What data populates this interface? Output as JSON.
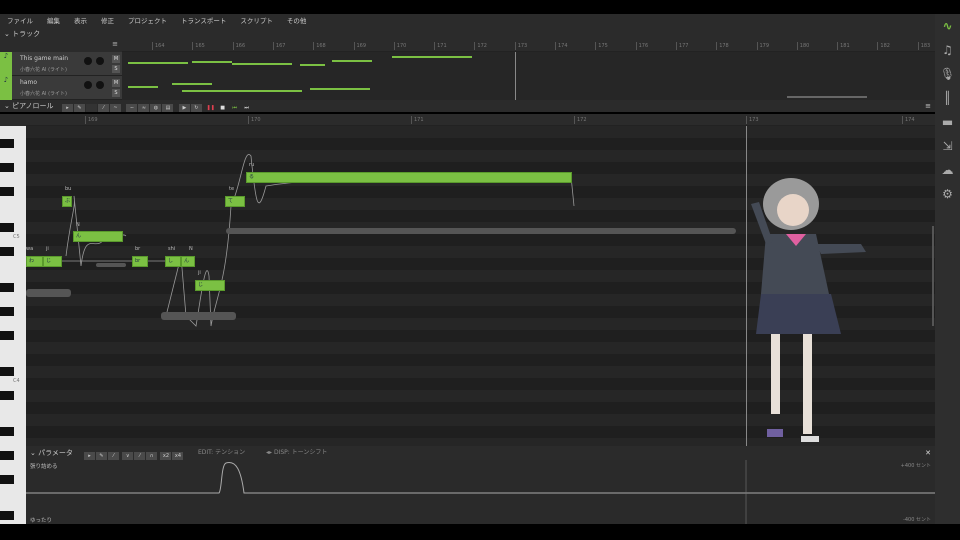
{
  "menu": [
    "ファイル",
    "編集",
    "表示",
    "修正",
    "プロジェクト",
    "トランスポート",
    "スクリプト",
    "その他"
  ],
  "track_panel": {
    "title": "トラック",
    "ruler": [
      "164",
      "165",
      "166",
      "167",
      "168",
      "169",
      "170",
      "171",
      "172",
      "173",
      "174",
      "175",
      "176",
      "177",
      "178",
      "179",
      "180",
      "181",
      "182",
      "183"
    ],
    "tracks": [
      {
        "name": "This game main",
        "voice": "小春六花 AI (ライト)",
        "mute": "M",
        "solo": "S"
      },
      {
        "name": "hamo",
        "voice": "小春六花 AI (ライト)",
        "mute": "M",
        "solo": "S"
      }
    ]
  },
  "piano_roll": {
    "title": "ピアノロール",
    "ruler": [
      "169",
      "170",
      "171",
      "172",
      "173",
      "174"
    ],
    "key_labels": {
      "c5": "C5",
      "c4": "C4"
    },
    "notes": [
      {
        "lyric": "bu",
        "text": "ぶ"
      },
      {
        "lyric": "N",
        "text": "ん"
      },
      {
        "lyric": "wa",
        "text": "わ"
      },
      {
        "lyric": "ji",
        "text": "じ"
      },
      {
        "lyric": "br",
        "text": "br"
      },
      {
        "lyric": "shi",
        "text": "し"
      },
      {
        "lyric": "N",
        "text": "ん"
      },
      {
        "lyric": "ji",
        "text": "じ"
      },
      {
        "lyric": "te",
        "text": "て"
      },
      {
        "lyric": "ru",
        "text": "る"
      }
    ]
  },
  "parameter": {
    "title": "パラメータ",
    "edit": "EDIT: テンション",
    "disp": "DISP: トーンシフト",
    "top_label": "張り詰める",
    "bottom_label": "ゆったり",
    "max": "+400 セント",
    "min": "-400 セント",
    "x2": "x2",
    "x4": "x4"
  },
  "sidebar_icons": [
    "logo-icon",
    "note-icon",
    "microphone-icon",
    "library-icon",
    "book-icon",
    "export-icon",
    "cloud-icon",
    "gear-icon"
  ],
  "colors": {
    "accent": "#7bc043",
    "transport_stop": "#e04050"
  }
}
